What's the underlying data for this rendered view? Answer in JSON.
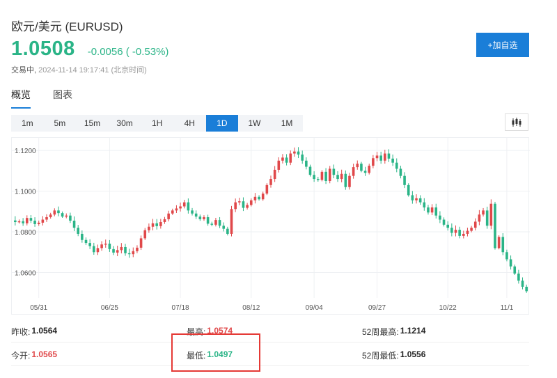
{
  "header": {
    "title": "欧元/美元 (EURUSD)",
    "price": "1.0508",
    "change": "-0.0056 ( -0.53%)",
    "status_label": "交易中,",
    "timestamp": "2024-11-14 19:17:41 (北京时间)",
    "add_button": "+加自选"
  },
  "tabs": [
    {
      "label": "概览",
      "active": true
    },
    {
      "label": "图表",
      "active": false
    }
  ],
  "periods": [
    {
      "label": "1m",
      "active": false
    },
    {
      "label": "5m",
      "active": false
    },
    {
      "label": "15m",
      "active": false
    },
    {
      "label": "30m",
      "active": false
    },
    {
      "label": "1H",
      "active": false
    },
    {
      "label": "4H",
      "active": false
    },
    {
      "label": "1D",
      "active": true
    },
    {
      "label": "1W",
      "active": false
    },
    {
      "label": "1M",
      "active": false
    }
  ],
  "chart_data": {
    "type": "candlestick",
    "y_ticks": [
      "1.1200",
      "1.1000",
      "1.0800",
      "1.0600"
    ],
    "y_tick_values": [
      1.12,
      1.1,
      1.08,
      1.06
    ],
    "ylim": [
      1.0475,
      1.1245
    ],
    "x_ticks": [
      "05/31",
      "06/25",
      "07/18",
      "08/12",
      "09/04",
      "09/27",
      "10/22",
      "11/1"
    ],
    "x_tick_index": [
      6,
      24,
      42,
      60,
      76,
      92,
      110,
      125
    ],
    "grid": true,
    "colors": {
      "up": "#e0484a",
      "down": "#2ab487"
    },
    "closes": [
      1.0848,
      1.0852,
      1.0842,
      1.0868,
      1.0855,
      1.0838,
      1.0845,
      1.086,
      1.0872,
      1.0885,
      1.0905,
      1.0892,
      1.0875,
      1.088,
      1.0855,
      1.082,
      1.079,
      1.076,
      1.0745,
      1.073,
      1.07,
      1.072,
      1.0738,
      1.0742,
      1.0715,
      1.0698,
      1.071,
      1.0725,
      1.0695,
      1.069,
      1.0705,
      1.0722,
      1.0768,
      1.0808,
      1.0825,
      1.0842,
      1.0828,
      1.0848,
      1.0862,
      1.089,
      1.0905,
      1.0915,
      1.0925,
      1.0945,
      1.0905,
      1.089,
      1.0875,
      1.0862,
      1.0872,
      1.084,
      1.0835,
      1.0858,
      1.083,
      1.0815,
      1.079,
      1.0912,
      1.0945,
      1.095,
      1.0918,
      1.0932,
      1.0955,
      1.0972,
      1.096,
      1.0988,
      1.103,
      1.106,
      1.1105,
      1.115,
      1.1165,
      1.114,
      1.1185,
      1.1195,
      1.118,
      1.115,
      1.112,
      1.108,
      1.106,
      1.1055,
      1.1095,
      1.105,
      1.111,
      1.108,
      1.106,
      1.1085,
      1.102,
      1.1075,
      1.1118,
      1.1135,
      1.11,
      1.109,
      1.1125,
      1.1162,
      1.1175,
      1.115,
      1.1185,
      1.116,
      1.114,
      1.111,
      1.1075,
      1.103,
      1.098,
      1.0955,
      1.0965,
      1.0945,
      1.092,
      1.0895,
      1.092,
      1.088,
      1.086,
      1.0835,
      1.082,
      1.0795,
      1.081,
      1.078,
      1.079,
      1.0805,
      1.082,
      1.085,
      1.0885,
      1.0905,
      1.083,
      1.0938,
      1.072,
      1.0775,
      1.07,
      1.0665,
      1.063,
      1.0595,
      1.056,
      1.053,
      1.0508
    ]
  },
  "stats": {
    "rows": [
      [
        {
          "label": "昨收:",
          "value": "1.0564",
          "tone": "flat"
        },
        {
          "label": "最高:",
          "value": "1.0574",
          "tone": "up"
        },
        {
          "label": "52周最高:",
          "value": "1.1214",
          "tone": "flat"
        }
      ],
      [
        {
          "label": "今开:",
          "value": "1.0565",
          "tone": "up"
        },
        {
          "label": "最低:",
          "value": "1.0497",
          "tone": "down"
        },
        {
          "label": "52周最低:",
          "value": "1.0556",
          "tone": "flat"
        }
      ]
    ]
  }
}
